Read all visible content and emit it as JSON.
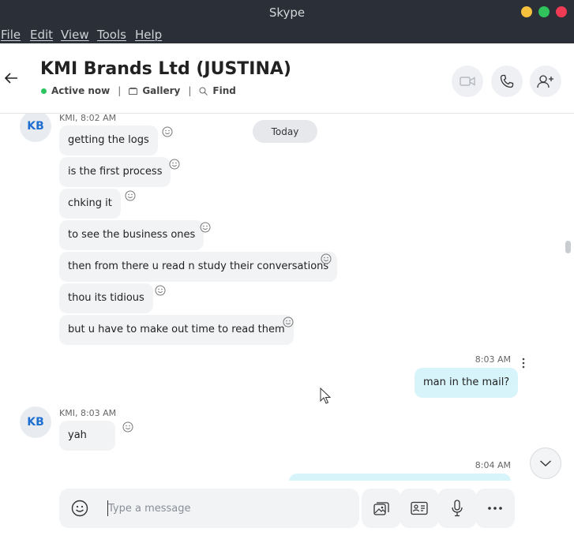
{
  "window": {
    "title": "Skype"
  },
  "menu": [
    "File",
    "Edit",
    "View",
    "Tools",
    "Help"
  ],
  "header": {
    "title": "KMI Brands Ltd (JUSTINA)",
    "status": "Active now",
    "gallery": "Gallery",
    "find": "Find"
  },
  "conversation": {
    "date_separator": "Today",
    "avatar_initials": "KB",
    "group1_meta": "KMI, 8:02 AM",
    "group1_messages": [
      "getting the logs",
      "is the first process",
      "chking it",
      "to see the business ones",
      "then from there u read n study their conversations",
      "thou its tidious",
      "but u have to make out time to read them"
    ],
    "own1_time": "8:03 AM",
    "own1_text": "man in the mail?",
    "group2_meta": "KMI, 8:03 AM",
    "group2_messages": [
      "yah"
    ],
    "own2_time": "8:04 AM"
  },
  "composer": {
    "placeholder": "Type a message"
  },
  "icons": {
    "react": "smiley-icon",
    "back": "back-arrow-icon",
    "video": "video-call-icon",
    "audio": "phone-call-icon",
    "add": "add-person-icon"
  },
  "colors": {
    "accent": "#1f6fd0",
    "online": "#2dc55e",
    "own_bubble": "#d8f4fb",
    "titlebar": "#2b2f37"
  }
}
